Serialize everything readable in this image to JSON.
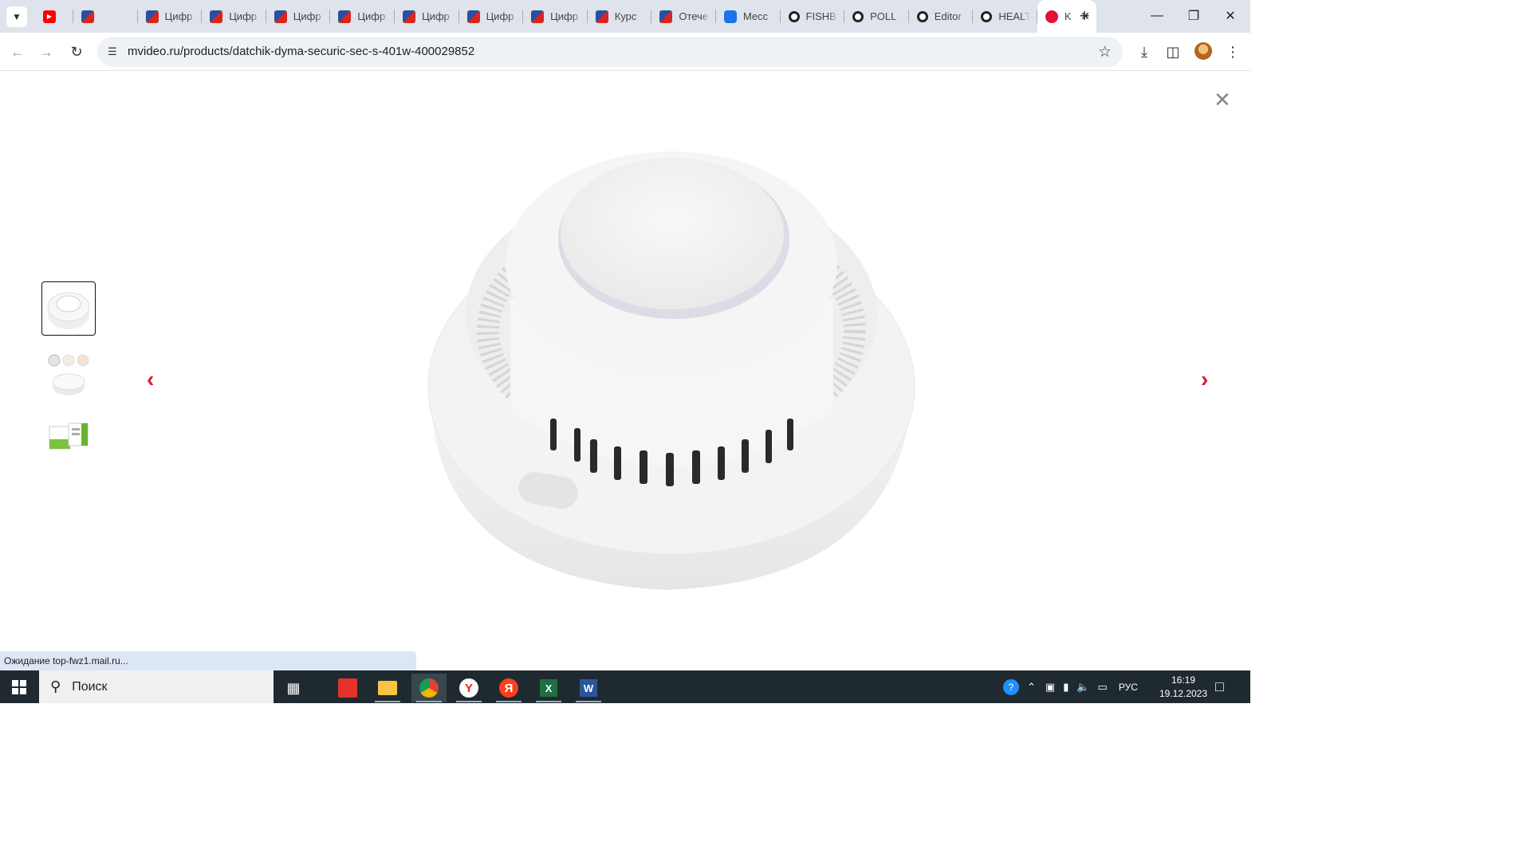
{
  "browser": {
    "tabs": [
      {
        "favicon": "youtube-favicon",
        "title": ""
      },
      {
        "favicon": "mgu-favicon",
        "title": ""
      },
      {
        "favicon": "mgu-favicon",
        "title": "Цифр"
      },
      {
        "favicon": "mgu-favicon",
        "title": "Цифр"
      },
      {
        "favicon": "mgu-favicon",
        "title": "Цифр"
      },
      {
        "favicon": "mgu-favicon",
        "title": "Цифр"
      },
      {
        "favicon": "mgu-favicon",
        "title": "Цифр"
      },
      {
        "favicon": "mgu-favicon",
        "title": "Цифр"
      },
      {
        "favicon": "mgu-favicon",
        "title": "Цифр"
      },
      {
        "favicon": "mgu-favicon",
        "title": "Курс"
      },
      {
        "favicon": "mgu-favicon",
        "title": "Отече"
      },
      {
        "favicon": "messenger-favicon",
        "title": "Месс"
      },
      {
        "favicon": "chrome-style-favicon",
        "title": "FISHB"
      },
      {
        "favicon": "chrome-style-favicon",
        "title": "POLL"
      },
      {
        "favicon": "chrome-style-favicon",
        "title": "Editor"
      },
      {
        "favicon": "chrome-style-favicon",
        "title": "HEALT"
      },
      {
        "favicon": "mvideo-favicon",
        "title": "K",
        "active": true
      }
    ],
    "url": "mvideo.ru/products/datchik-dyma-securic-sec-s-401w-400029852",
    "status_text": "Ожидание top-fwz1.mail.ru..."
  },
  "gallery": {
    "thumbnails": [
      {
        "name": "smoke-detector-front",
        "active": true
      },
      {
        "name": "smoke-detector-views",
        "active": false
      },
      {
        "name": "package-box",
        "active": false
      }
    ],
    "accent_color": "#e31235"
  },
  "taskbar": {
    "search_placeholder": "Поиск",
    "language": "РУС",
    "time": "16:19",
    "date": "19.12.2023"
  }
}
